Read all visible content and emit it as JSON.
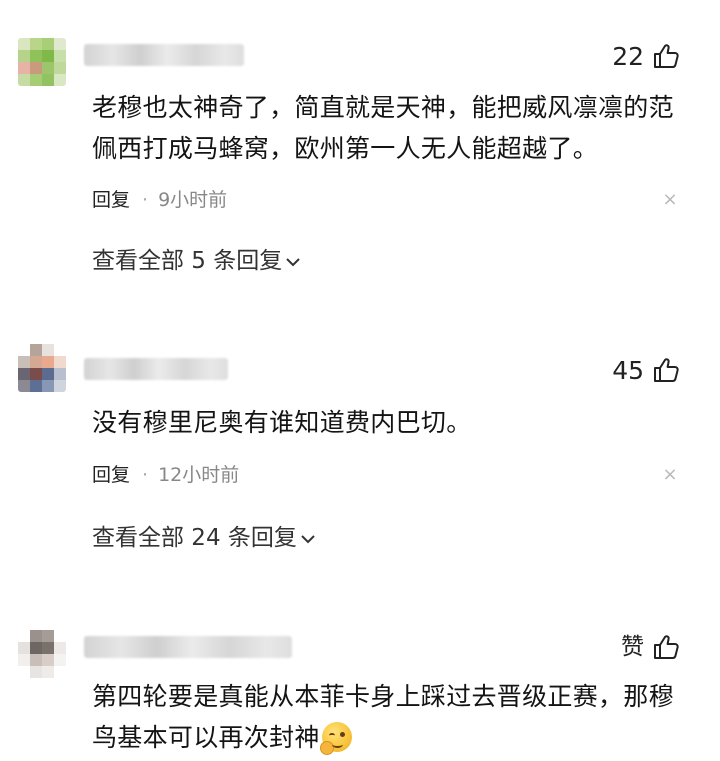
{
  "comments": [
    {
      "likes": "22",
      "text_lines": [
        "老穆也太神奇了，简直就是天神，能把威风凛凛的范",
        "佩西打成马蜂窝，欧州第一人无人能超越了。"
      ],
      "reply_label": "回复",
      "time": "9小时前",
      "view_all": "查看全部 5 条回复"
    },
    {
      "likes": "45",
      "text_lines": [
        "没有穆里尼奥有谁知道费内巴切。"
      ],
      "reply_label": "回复",
      "time": "12小时前",
      "view_all": "查看全部 24 条回复"
    },
    {
      "likes": "赞",
      "text_lines": [
        "第四轮要是真能从本菲卡身上踩过去晋级正赛，那穆",
        "鸟基本可以再次封神"
      ]
    }
  ],
  "icons": {
    "like": "thumbs-up-icon",
    "close": "close-icon",
    "chevron": "chevron-down-icon",
    "emoji": "smirk-emoji-icon"
  },
  "colors": {
    "text": "#141414",
    "time": "#888888",
    "dot": "#aaaaaa",
    "close": "#b8b8b8"
  }
}
